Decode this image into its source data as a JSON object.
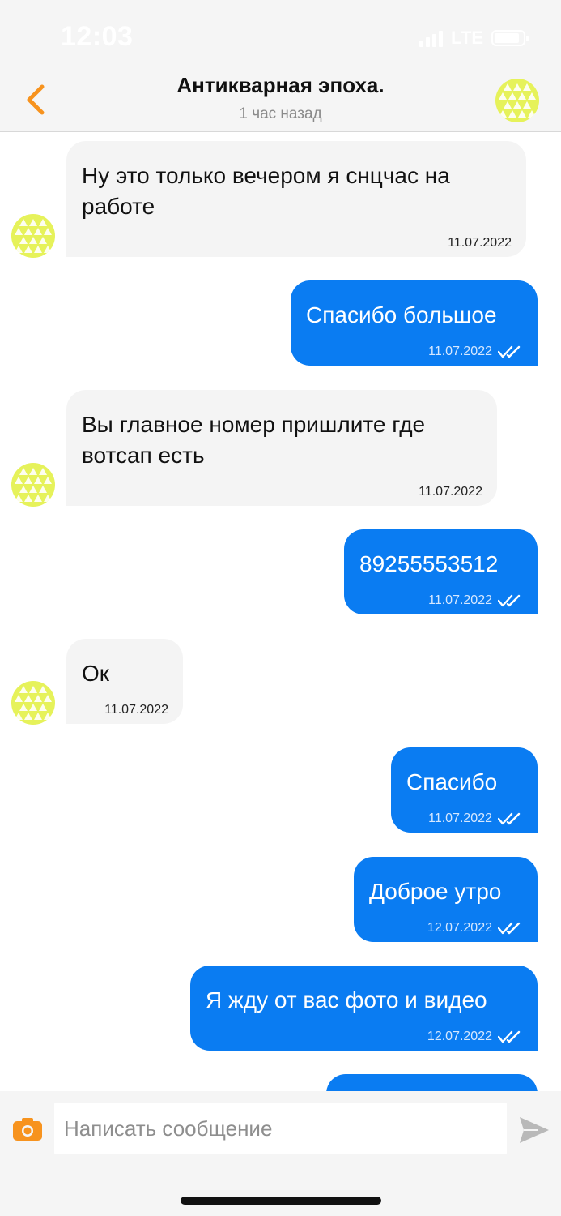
{
  "status_bar": {
    "time": "12:03",
    "network": "LTE"
  },
  "header": {
    "title": "Антикварная эпоха.",
    "subtitle": "1 час назад",
    "back_icon": "chevron-left-icon",
    "avatar_icon": "pattern-avatar-icon"
  },
  "messages": [
    {
      "direction": "in",
      "text": "Ну это только вечером я снцчас на\nработе",
      "date": "11.07.2022"
    },
    {
      "direction": "out",
      "text": "Спасибо большое",
      "date": "11.07.2022",
      "read": true
    },
    {
      "direction": "in",
      "text": "Вы главное номер пришлите где\nвотсап есть",
      "date": "11.07.2022"
    },
    {
      "direction": "out",
      "text": "89255553512",
      "date": "11.07.2022",
      "read": true
    },
    {
      "direction": "in",
      "text": "Ок",
      "date": "11.07.2022"
    },
    {
      "direction": "out",
      "text": "Спасибо",
      "date": "11.07.2022",
      "read": true
    },
    {
      "direction": "out",
      "text": "Доброе утро",
      "date": "12.07.2022",
      "read": true
    },
    {
      "direction": "out",
      "text": "Я жду от вас фото и видео",
      "date": "12.07.2022",
      "read": true
    }
  ],
  "composer": {
    "placeholder": "Написать сообщение",
    "camera_icon": "camera-icon",
    "send_icon": "send-icon"
  },
  "colors": {
    "accent": "#f7931e",
    "outgoing_bubble": "#0a7cf2",
    "incoming_bubble": "#f4f4f4",
    "avatar": "#e6f25a"
  }
}
